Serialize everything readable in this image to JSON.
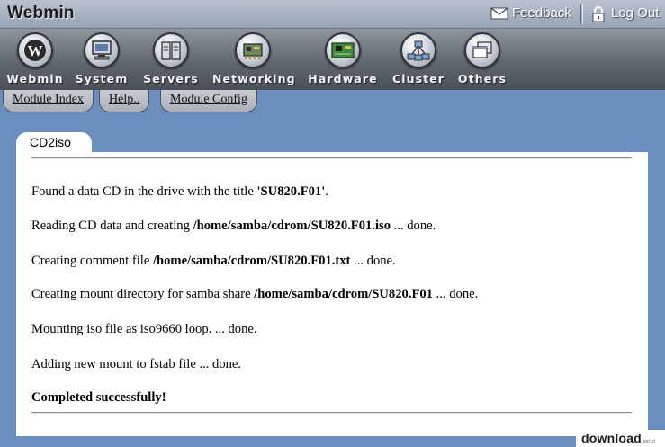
{
  "header": {
    "logo_text": "Webmin",
    "feedback_label": "Feedback",
    "logout_label": "Log Out"
  },
  "categories": [
    {
      "label": "Webmin",
      "icon": "webmin-logo-icon"
    },
    {
      "label": "System",
      "icon": "monitor-icon"
    },
    {
      "label": "Servers",
      "icon": "server-icon"
    },
    {
      "label": "Networking",
      "icon": "network-card-icon"
    },
    {
      "label": "Hardware",
      "icon": "circuit-board-icon"
    },
    {
      "label": "Cluster",
      "icon": "cluster-icon"
    },
    {
      "label": "Others",
      "icon": "windows-stack-icon"
    }
  ],
  "module_tabs": [
    "Module Index",
    "Help..",
    "Module Config"
  ],
  "page": {
    "title": "CD2iso",
    "lines": [
      {
        "pre": "Found a data CD in the drive with the title ",
        "bold": "'SU820.F01'",
        "post": "."
      },
      {
        "pre": "Reading CD data and creating ",
        "bold": "/home/samba/cdrom/SU820.F01.iso",
        "post": " ... done."
      },
      {
        "pre": "Creating comment file ",
        "bold": "/home/samba/cdrom/SU820.F01.txt",
        "post": " ... done."
      },
      {
        "pre": "Creating mount directory for samba share ",
        "bold": "/home/samba/cdrom/SU820.F01",
        "post": " ... done."
      },
      {
        "pre": "Mounting iso file as iso9660 loop. ... done.",
        "bold": "",
        "post": ""
      },
      {
        "pre": "Adding new mount to fstab file ... done.",
        "bold": "",
        "post": ""
      },
      {
        "pre": "",
        "bold": "Completed successfully!",
        "post": ""
      }
    ]
  },
  "watermark": {
    "text": "download",
    "suffix": ".net.pl"
  },
  "colors": {
    "background": "#6a8fbf",
    "panel": "#ffffff",
    "title_bar": "#a9b3c1",
    "category_bar": "#60676f"
  }
}
